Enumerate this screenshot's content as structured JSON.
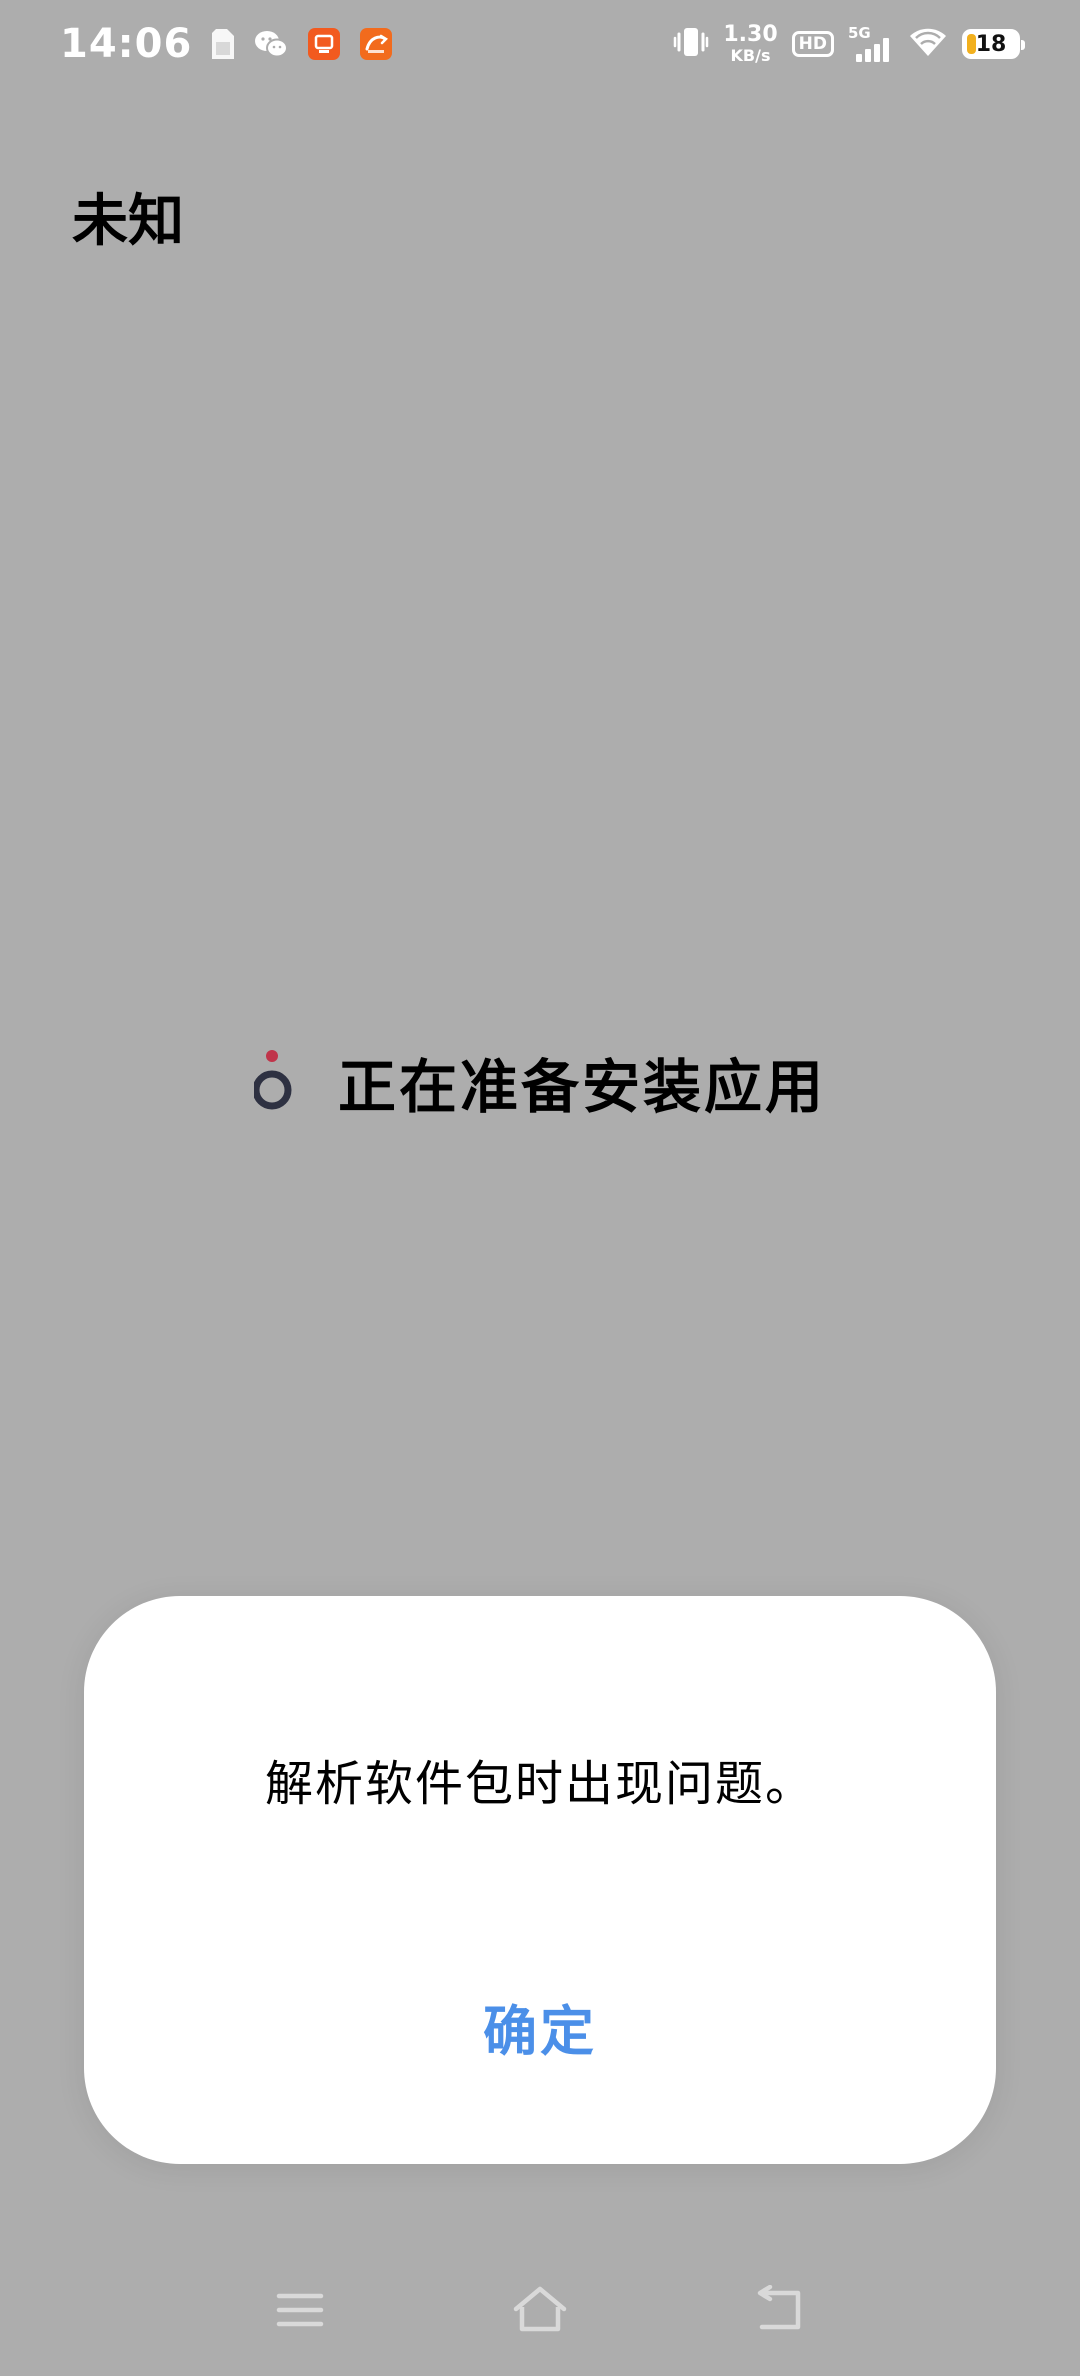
{
  "status_bar": {
    "time": "14:06",
    "net_speed_value": "1.30",
    "net_speed_unit": "KB/s",
    "hd_label": "HD",
    "network_type": "5G",
    "battery_level": "18",
    "battery_fraction": 0.18,
    "icons": [
      "sim-card-icon",
      "wechat-icon",
      "app-notification-icon",
      "1688-app-icon",
      "vibrate-icon",
      "signal-icon",
      "wifi-icon",
      "battery-icon"
    ],
    "colors": {
      "app_badge_1": "#f25a1f",
      "app_badge_2": "#f26b1d",
      "battery_fill": "#f2b01e"
    }
  },
  "page": {
    "title": "未知"
  },
  "progress": {
    "text": "正在准备安装应用",
    "spinner_dot_color": "#c0344a",
    "spinner_ring_color": "#2e3142"
  },
  "dialog": {
    "message": "解析软件包时出现问题。",
    "confirm_label": "确定",
    "accent_color": "#4b8fe8"
  },
  "nav_bar": {
    "icons": [
      "menu-icon",
      "home-icon",
      "back-icon"
    ]
  }
}
